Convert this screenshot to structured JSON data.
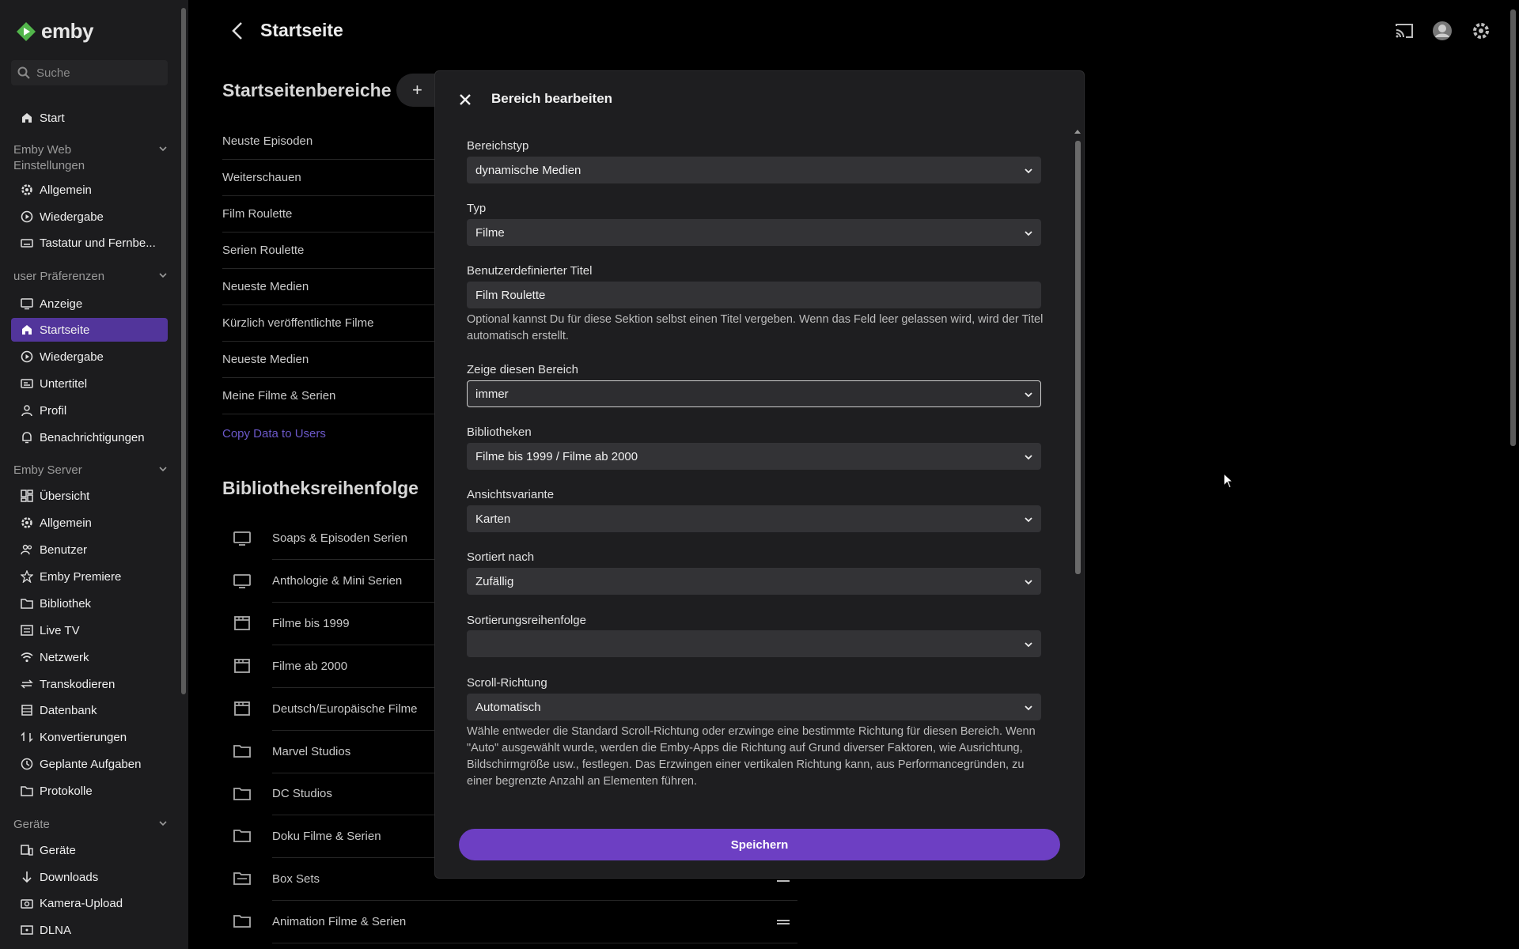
{
  "sidebar": {
    "logo_text": "emby",
    "search_placeholder": "Suche",
    "start": "Start",
    "groups": {
      "web": "Emby Web Einstellungen",
      "user": "user Präferenzen",
      "server": "Emby Server",
      "devices": "Geräte"
    },
    "web_items": [
      "Allgemein",
      "Wiedergabe",
      "Tastatur und Fernbe..."
    ],
    "user_items": [
      "Anzeige",
      "Startseite",
      "Wiedergabe",
      "Untertitel",
      "Profil",
      "Benachrichtigungen"
    ],
    "server_items": [
      "Übersicht",
      "Allgemein",
      "Benutzer",
      "Emby Premiere",
      "Bibliothek",
      "Live TV",
      "Netzwerk",
      "Transkodieren",
      "Datenbank",
      "Konvertierungen",
      "Geplante Aufgaben",
      "Protokolle"
    ],
    "device_items": [
      "Geräte",
      "Downloads",
      "Kamera-Upload",
      "DLNA"
    ]
  },
  "header": {
    "title": "Startseite"
  },
  "main": {
    "sections_title": "Startseitenbereiche",
    "add_label": "+",
    "sections": [
      "Neuste Episoden",
      "Weiterschauen",
      "Film Roulette",
      "Serien Roulette",
      "Neueste Medien",
      "Kürzlich veröffentlichte Filme",
      "Neueste Medien",
      "Meine Filme & Serien"
    ],
    "copy_link": "Copy Data to Users",
    "library_title": "Bibliotheksreihenfolge",
    "libraries": [
      "Soaps & Episoden Serien",
      "Anthologie & Mini Serien",
      "Filme bis 1999",
      "Filme ab 2000",
      "Deutsch/Europäische Filme",
      "Marvel Studios",
      "DC Studios",
      "Doku Filme & Serien",
      "Box Sets",
      "Animation Filme & Serien"
    ]
  },
  "dialog": {
    "title": "Bereich bearbeiten",
    "fields": [
      {
        "label": "Bereichstyp",
        "value": "dynamische Medien"
      },
      {
        "label": "Typ",
        "value": "Filme"
      },
      {
        "label": "Benutzerdefinierter Titel",
        "value": "Film Roulette"
      },
      {
        "label": "Zeige diesen Bereich",
        "value": "immer"
      },
      {
        "label": "Bibliotheken",
        "value": "Filme bis 1999 / Filme ab 2000"
      },
      {
        "label": "Ansichtsvariante",
        "value": "Karten"
      },
      {
        "label": "Sortiert nach",
        "value": "Zufällig"
      },
      {
        "label": "Sortierungsreihenfolge",
        "value": ""
      },
      {
        "label": "Scroll-Richtung",
        "value": "Automatisch"
      }
    ],
    "title_help": "Optional kannst Du für diese Sektion selbst einen Titel vergeben. Wenn das Feld leer gelassen wird, wird der Titel automatisch erstellt.",
    "scroll_help": "Wähle entweder die Standard Scroll-Richtung oder erzwinge eine bestimmte Richtung für diesen Bereich. Wenn \"Auto\" ausgewählt wurde, werden die Emby-Apps die Richtung auf Grund diverser Faktoren, wie Ausrichtung, Bildschirmgröße usw., festlegen. Das Erzwingen einer vertikalen Richtung kann, aus Performancegründen, zu einer begrenzte Anzahl an Elementen führen.",
    "save_label": "Speichern"
  },
  "colors": {
    "accent": "#52359b",
    "save": "#6d3fc3",
    "link": "#6b58c9"
  }
}
